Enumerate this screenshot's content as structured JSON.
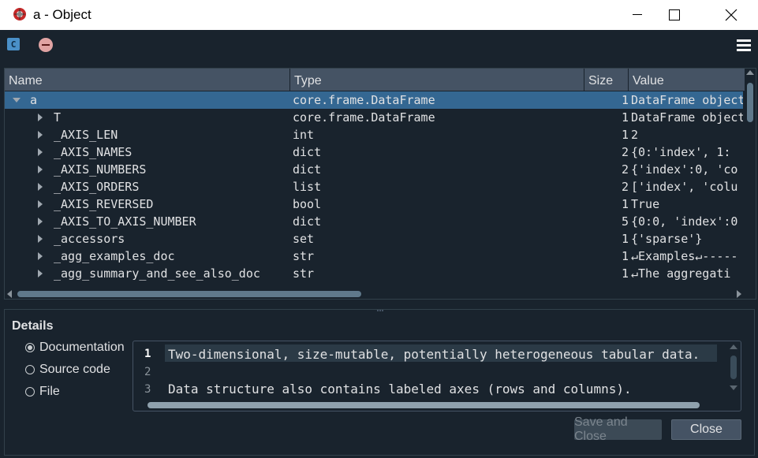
{
  "window": {
    "title": "a - Object"
  },
  "toolbar": {
    "c_label": "C"
  },
  "table": {
    "headers": {
      "name": "Name",
      "type": "Type",
      "size": "Size",
      "value": "Value"
    },
    "rows": [
      {
        "name": "a",
        "type": "core.frame.DataFrame",
        "size": "1",
        "value": "DataFrame object"
      },
      {
        "name": "T",
        "type": "core.frame.DataFrame",
        "size": "1",
        "value": "DataFrame object"
      },
      {
        "name": "_AXIS_LEN",
        "type": "int",
        "size": "1",
        "value": "2"
      },
      {
        "name": "_AXIS_NAMES",
        "type": "dict",
        "size": "2",
        "value": "{0:'index', 1:"
      },
      {
        "name": "_AXIS_NUMBERS",
        "type": "dict",
        "size": "2",
        "value": "{'index':0, 'co"
      },
      {
        "name": "_AXIS_ORDERS",
        "type": "list",
        "size": "2",
        "value": "['index', 'colu"
      },
      {
        "name": "_AXIS_REVERSED",
        "type": "bool",
        "size": "1",
        "value": "True"
      },
      {
        "name": "_AXIS_TO_AXIS_NUMBER",
        "type": "dict",
        "size": "5",
        "value": "{0:0, 'index':0"
      },
      {
        "name": "_accessors",
        "type": "set",
        "size": "1",
        "value": "{'sparse'}"
      },
      {
        "name": "_agg_examples_doc",
        "type": "str",
        "size": "1",
        "value": "↵Examples↵-----"
      },
      {
        "name": "_agg_summary_and_see_also_doc",
        "type": "str",
        "size": "1",
        "value": "↵The aggregati"
      }
    ]
  },
  "details": {
    "title": "Details",
    "options": [
      "Documentation",
      "Source code",
      "File"
    ],
    "selected": "Documentation",
    "lines": [
      {
        "num": "1",
        "text": "Two-dimensional, size-mutable, potentially heterogeneous tabular data."
      },
      {
        "num": "2",
        "text": ""
      },
      {
        "num": "3",
        "text": "Data structure also contains labeled axes (rows and columns)."
      }
    ]
  },
  "buttons": {
    "save_close": "Save and Close",
    "close": "Close"
  }
}
